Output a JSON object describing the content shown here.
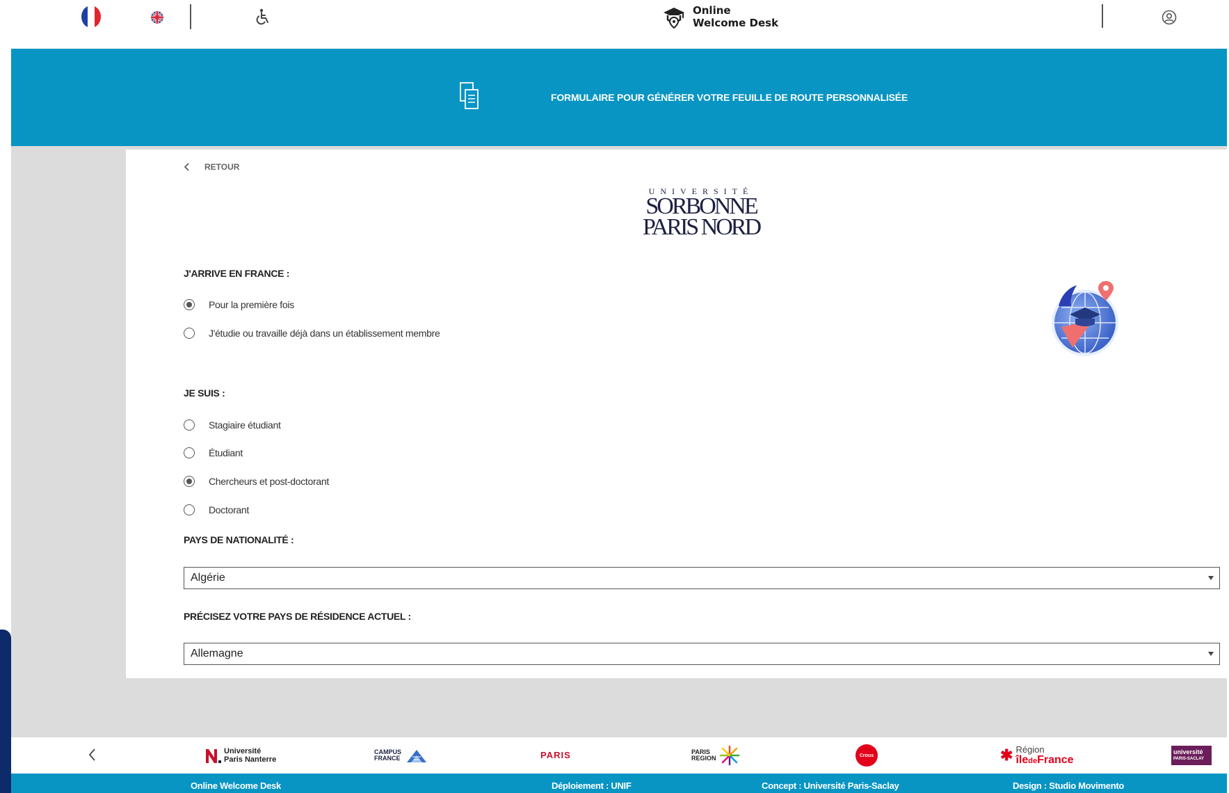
{
  "topbar": {
    "lang_fr_icon": "france-flag-icon",
    "lang_en_icon": "uk-flag-icon",
    "accessibility_icon": "wheelchair-icon",
    "brand_line1": "Online",
    "brand_line2": "Welcome Desk",
    "account_icon": "user-icon"
  },
  "banner": {
    "icon": "document-icon",
    "title": "FORMULAIRE POUR GÉNÉRER VOTRE FEUILLE DE ROUTE PERSONNALISÉE",
    "color": "#0895c4"
  },
  "form": {
    "back_label": "RETOUR",
    "logo": {
      "line1": "UNIVERSITÉ",
      "line2": "SORBONNE",
      "line3": "PARIS NORD"
    },
    "arrival": {
      "label": "J'ARRIVE EN FRANCE :",
      "options": [
        {
          "label": "Pour la première fois",
          "checked": true
        },
        {
          "label": "J'étudie ou travaille déjà dans un établissement membre",
          "checked": false
        }
      ]
    },
    "status": {
      "label": "JE SUIS :",
      "options": [
        {
          "label": "Stagiaire étudiant",
          "checked": false
        },
        {
          "label": "Étudiant",
          "checked": false
        },
        {
          "label": "Chercheurs et post-doctorant",
          "checked": true
        },
        {
          "label": "Doctorant",
          "checked": false
        }
      ]
    },
    "nationality": {
      "label": "PAYS DE NATIONALITÉ :",
      "value": "Algérie"
    },
    "residence": {
      "label": "PRÉCISEZ VOTRE PAYS DE RÉSIDENCE ACTUEL :",
      "value": "Allemagne"
    }
  },
  "partners": {
    "nanterre_line1": "Université",
    "nanterre_line2": "Paris Nanterre",
    "campus_line1": "CAMPUS",
    "campus_line2": "FRANCE",
    "paris_label": "PARIS",
    "paris_region_line1": "PARIS",
    "paris_region_line2": "REGION",
    "crous_label": "Crous",
    "idf_line1": "Région",
    "idf_line2a": "île",
    "idf_line2b": "de",
    "idf_line2c": "France",
    "saclay_line1": "université",
    "saclay_line2": "PARIS-SACLAY"
  },
  "footer": {
    "item1": "Online Welcome Desk",
    "item2": "Déploiement : UNIF",
    "item3": "Concept : Université Paris-Saclay",
    "item4": "Design : Studio Movimento"
  }
}
